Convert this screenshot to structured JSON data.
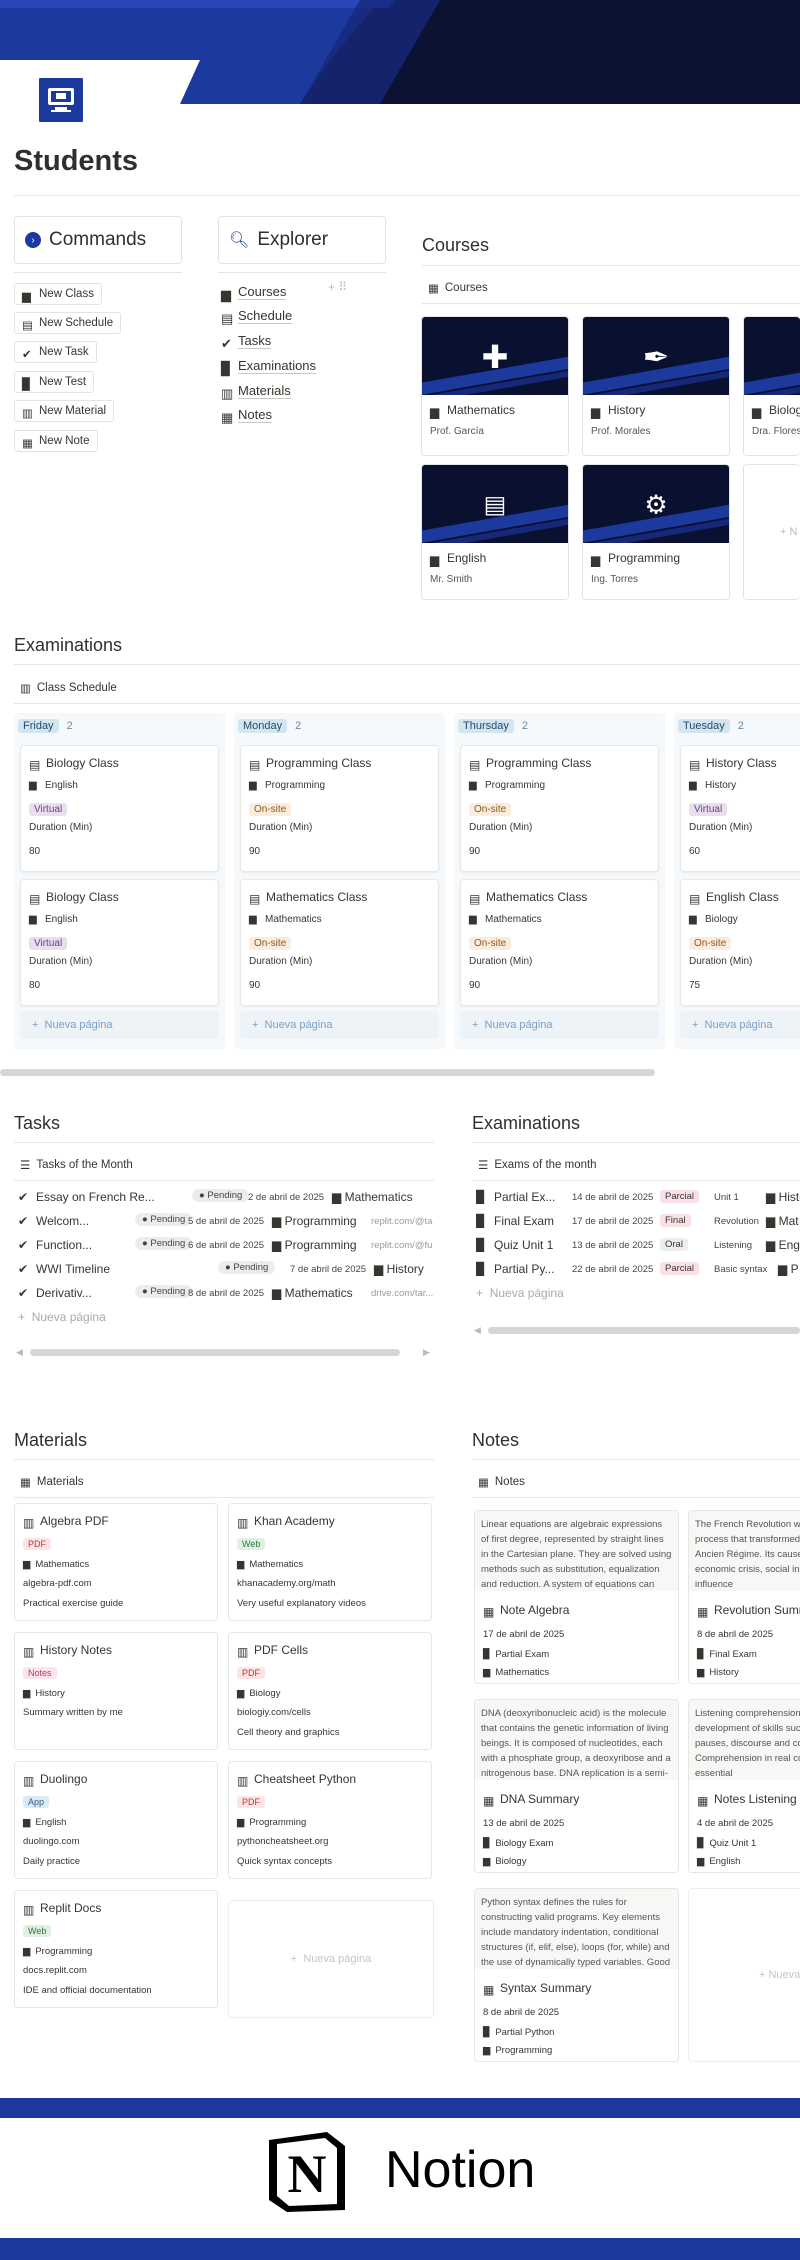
{
  "page": {
    "title": "Students"
  },
  "commands": {
    "title": "Commands",
    "items": [
      "New Class",
      "New Schedule",
      "New Task",
      "New Test",
      "New Material",
      "New Note"
    ]
  },
  "explorer": {
    "title": "Explorer",
    "items": [
      "Courses",
      "Schedule",
      "Tasks",
      "Examinations",
      "Materials",
      "Notes"
    ]
  },
  "courses": {
    "title": "Courses",
    "view": "Courses",
    "cards": [
      {
        "name": "Mathematics",
        "teacher": "Prof. García"
      },
      {
        "name": "History",
        "teacher": "Prof. Morales"
      },
      {
        "name": "Biolog",
        "teacher": "Dra. Flores"
      },
      {
        "name": "English",
        "teacher": "Mr. Smith"
      },
      {
        "name": "Programming",
        "teacher": "Ing. Torres"
      }
    ],
    "new": "N"
  },
  "schedule": {
    "title": "Examinations",
    "view": "Class Schedule",
    "add": "Nueva página",
    "duration_label": "Duration (Min)",
    "columns": [
      {
        "day": "Friday",
        "count": "2",
        "cards": [
          {
            "title": "Biology Class",
            "course": "English",
            "mode": "Virtual",
            "duration": "80"
          },
          {
            "title": "Biology Class",
            "course": "English",
            "mode": "Virtual",
            "duration": "80"
          }
        ]
      },
      {
        "day": "Monday",
        "count": "2",
        "cards": [
          {
            "title": "Programming Class",
            "course": "Programming",
            "mode": "On-site",
            "duration": "90"
          },
          {
            "title": "Mathematics Class",
            "course": "Mathematics",
            "mode": "On-site",
            "duration": "90"
          }
        ]
      },
      {
        "day": "Thursday",
        "count": "2",
        "cards": [
          {
            "title": "Programming Class",
            "course": "Programming",
            "mode": "On-site",
            "duration": "90"
          },
          {
            "title": "Mathematics Class",
            "course": "Mathematics",
            "mode": "On-site",
            "duration": "90"
          }
        ]
      },
      {
        "day": "Tuesday",
        "count": "2",
        "cards": [
          {
            "title": "History Class",
            "course": "History",
            "mode": "Virtual",
            "duration": "60"
          },
          {
            "title": "English Class",
            "course": "Biology",
            "mode": "On-site",
            "duration": "75"
          }
        ]
      }
    ]
  },
  "tasks": {
    "title": "Tasks",
    "view": "Tasks of the Month",
    "add": "Nueva página",
    "rows": [
      {
        "name": "Essay on French Re...",
        "status": "Pending",
        "date": "2 de abril de 2025",
        "course": "Mathematics",
        "link": ""
      },
      {
        "name": "Welcom...",
        "status": "Pending",
        "date": "5 de abril de 2025",
        "course": "Programming",
        "link": "replit.com/@ta"
      },
      {
        "name": "Function...",
        "status": "Pending",
        "date": "6 de abril de 2025",
        "course": "Programming",
        "link": "replit.com/@fu"
      },
      {
        "name": "WWI Timeline",
        "status": "Pending",
        "date": "7 de abril de 2025",
        "course": "History",
        "link": ""
      },
      {
        "name": "Derivativ...",
        "status": "Pending",
        "date": "8 de abril de 2025",
        "course": "Mathematics",
        "link": "drive.com/tar..."
      }
    ]
  },
  "exams": {
    "title": "Examinations",
    "view": "Exams of the month",
    "add": "Nueva página",
    "rows": [
      {
        "name": "Partial Ex...",
        "date": "14 de abril de 2025",
        "type": "Parcial",
        "topic": "Unit 1",
        "course": "Histor"
      },
      {
        "name": "Final Exam",
        "date": "17 de abril de 2025",
        "type": "Final",
        "topic": "Revolution",
        "course": "Mat"
      },
      {
        "name": "Quiz Unit 1",
        "date": "13 de abril de 2025",
        "type": "Oral",
        "topic": "Listening",
        "course": "Englis"
      },
      {
        "name": "Partial Py...",
        "date": "22 de abril de 2025",
        "type": "Parcial",
        "topic": "Basic syntax",
        "course": "P"
      }
    ]
  },
  "materials": {
    "title": "Materials",
    "view": "Materials",
    "add": "Nueva página",
    "cards": [
      {
        "name": "Algebra PDF",
        "type": "PDF",
        "course": "Mathematics",
        "link": "algebra-pdf.com",
        "desc": "Practical exercise guide"
      },
      {
        "name": "Khan Academy",
        "type": "Web",
        "course": "Mathematics",
        "link": "khanacademy.org/math",
        "desc": "Very useful explanatory videos"
      },
      {
        "name": "History Notes",
        "type": "Notes",
        "course": "History",
        "link": "",
        "desc": "Summary written by me"
      },
      {
        "name": "PDF Cells",
        "type": "PDF",
        "course": "Biology",
        "link": "biologiy.com/cells",
        "desc": "Cell theory and graphics"
      },
      {
        "name": "Duolingo",
        "type": "App",
        "course": "English",
        "link": "duolingo.com",
        "desc": "Daily practice"
      },
      {
        "name": "Cheatsheet Python",
        "type": "PDF",
        "course": "Programming",
        "link": "pythoncheatsheet.org",
        "desc": "Quick syntax concepts"
      },
      {
        "name": "Replit Docs",
        "type": "Web",
        "course": "Programming",
        "link": "docs.replit.com",
        "desc": "IDE and official documentation"
      }
    ]
  },
  "notes": {
    "title": "Notes",
    "view": "Notes",
    "add": "Nueva p",
    "cards": [
      {
        "preview": "Linear equations are algebraic expressions of first degree, represented by straight lines in the Cartesian plane. They are solved using methods such as substitution, equalization and reduction. A system of equations can",
        "name": "Note Algebra",
        "date": "17 de abril de 2025",
        "exam": "Partial Exam",
        "course": "Mathematics"
      },
      {
        "preview": "The French Revolution was a political process that transformed the structure of the Ancien Régime. Its causes were the economic crisis, social inequality and the influence",
        "name": "Revolution Summ",
        "date": "8 de abril de 2025",
        "exam": "Final Exam",
        "course": "History"
      },
      {
        "preview": "DNA (deoxyribonucleic acid) is the molecule that contains the genetic information of living beings. It is composed of nucleotides, each with a phosphate group, a deoxyribose and a nitrogenous base. DNA replication is a semi-",
        "name": "DNA Summary",
        "date": "13 de abril de 2025",
        "exam": "Biology Exam",
        "course": "Biology"
      },
      {
        "preview": "Listening comprehension is key to the development of skills such as intonation, pauses, discourse and contextual vocabulary. Comprehension in real conversations is essential",
        "name": "Notes Listening",
        "date": "4 de abril de 2025",
        "exam": "Quiz Unit 1",
        "course": "English"
      },
      {
        "preview": "Python syntax defines the rules for constructing valid programs. Key elements include mandatory indentation, conditional structures (if, elif, else), loops (for, while) and the use of dynamically typed variables. Good",
        "name": "Syntax Summary",
        "date": "8 de abril de 2025",
        "exam": "Partial Python",
        "course": "Programming"
      }
    ]
  },
  "footer": {
    "brand": "Notion"
  },
  "colors": {
    "accent": "#1c3a9e",
    "navy": "#0b1233"
  }
}
